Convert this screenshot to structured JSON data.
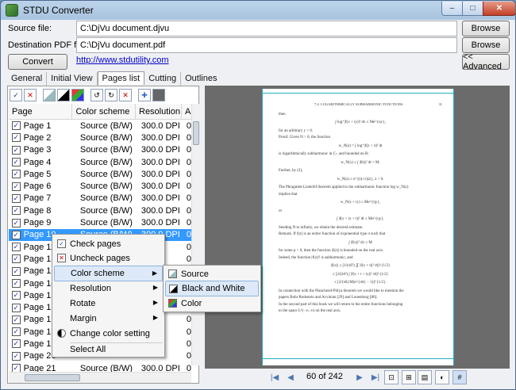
{
  "window": {
    "title": "STDU Converter",
    "min_glyph": "–",
    "max_glyph": "□",
    "close_glyph": "✕"
  },
  "fields": {
    "source_label": "Source file:",
    "source_value": "C:\\DjVu document.djvu",
    "dest_label": "Destination PDF file:",
    "dest_value": "C:\\DjVu document.pdf",
    "browse_label": "Browse"
  },
  "actions": {
    "convert_label": "Convert",
    "website_link": "http://www.stdutility.com",
    "advanced_label": "<< Advanced"
  },
  "tabs": [
    "General",
    "Initial View",
    "Pages list",
    "Cutting",
    "Outlines"
  ],
  "table": {
    "headers": [
      "Page",
      "Color scheme",
      "Resolution",
      "A"
    ],
    "rows": [
      {
        "page": "Page 1",
        "scheme": "Source (B/W)",
        "res": "300.0 DPI",
        "a": "0"
      },
      {
        "page": "Page 2",
        "scheme": "Source (B/W)",
        "res": "300.0 DPI",
        "a": "0"
      },
      {
        "page": "Page 3",
        "scheme": "Source (B/W)",
        "res": "300.0 DPI",
        "a": "0"
      },
      {
        "page": "Page 4",
        "scheme": "Source (B/W)",
        "res": "300.0 DPI",
        "a": "0"
      },
      {
        "page": "Page 5",
        "scheme": "Source (B/W)",
        "res": "300.0 DPI",
        "a": "0"
      },
      {
        "page": "Page 6",
        "scheme": "Source (B/W)",
        "res": "300.0 DPI",
        "a": "0"
      },
      {
        "page": "Page 7",
        "scheme": "Source (B/W)",
        "res": "300.0 DPI",
        "a": "0"
      },
      {
        "page": "Page 8",
        "scheme": "Source (B/W)",
        "res": "300.0 DPI",
        "a": "0"
      },
      {
        "page": "Page 9",
        "scheme": "Source (B/W)",
        "res": "300.0 DPI",
        "a": "0"
      },
      {
        "page": "Page 10",
        "scheme": "Source (B/W)",
        "res": "300.0 DPI",
        "a": "0"
      },
      {
        "page": "Page 11",
        "scheme": "",
        "res": "",
        "a": "0"
      },
      {
        "page": "Page 12",
        "scheme": "",
        "res": "",
        "a": "0"
      },
      {
        "page": "Page 13",
        "scheme": "",
        "res": "",
        "a": "0"
      },
      {
        "page": "Page 14",
        "scheme": "",
        "res": "",
        "a": "0"
      },
      {
        "page": "Page 15",
        "scheme": "",
        "res": "",
        "a": "0"
      },
      {
        "page": "Page 16",
        "scheme": "",
        "res": "",
        "a": "0"
      },
      {
        "page": "Page 17",
        "scheme": "",
        "res": "",
        "a": "0"
      },
      {
        "page": "Page 18",
        "scheme": "",
        "res": "",
        "a": "0"
      },
      {
        "page": "Page 19",
        "scheme": "",
        "res": "",
        "a": "0"
      },
      {
        "page": "Page 20",
        "scheme": "",
        "res": "",
        "a": "0"
      },
      {
        "page": "Page 21",
        "scheme": "Source (B/W)",
        "res": "300.0 DPI",
        "a": "0"
      }
    ]
  },
  "context_menu": {
    "check_pages": "Check pages",
    "uncheck_pages": "Uncheck pages",
    "color_scheme": "Color scheme",
    "resolution": "Resolution",
    "rotate": "Rotate",
    "margin": "Margin",
    "change_color": "Change color setting",
    "select_all": "Select All"
  },
  "submenu": {
    "source": "Source",
    "black_white": "Black and White",
    "color": "Color"
  },
  "preview": {
    "header": "7.4. LOGARITHMICALLY SUBHARMONIC FUNCTIONS",
    "page_no": "31",
    "lines": [
      "then",
      "∫ log⁺|f(x + iy)|² dx ≤ Me^{ηv},",
      "for an arbitrary y > 0.",
      "Proof. Given N > 0, the function",
      "w_N(z) = ∫ log⁺|f(z + t)|² dt",
      "is logarithmically subharmonic in C₊ and bounded on R:",
      "w_N(x) ≤ ∫ |f(t)|² dt = M.",
      "Further, by (3),",
      "w_N(z) ≤ e^{(η+ε)|z|}, z > 0.",
      "The Phragmén-Lindelöf theorem applied to the subharmonic function log w_N(z)",
      "implies that",
      "w_N(x + iy) ≤ Me^{ηy},",
      "or",
      "∫ |f(x + iy + t)|² dt ≤ Me^{ηy}.",
      "Sending N to infinity, we obtain the desired estimate.",
      "Remark. If f(z) is an entire function of exponential type σ such that",
      "∫ |f(x)|² dx ≤ M",
      "for some p > 0, then the function |f(z)| is bounded on the real axis.",
      "Indeed, the function |f(z)|² is subharmonic, and",
      "|f(x)| ≤ [1/(πδ²) ∬ |f(x + t)|² dt]^{1/2}",
      "≤ [2/(πδ²) ∫ |f(x + t + iy)|² dt]^{1/2}",
      "≤ [2/(πδ) M(e^{σδ} − 1)]^{1/2}.",
      "In connection with the Plancherel-Pólya theorem we would like to mention the",
      "papers Bohr Rothstein and Acvinian [29] and Lunenburg [86].",
      "In the second part of this book we will return to the entire functions belonging",
      "to the space Lᵖ(−∞, ∞) on the real axis."
    ]
  },
  "navigation": {
    "page_indicator": "60 of 242"
  },
  "colors": {
    "accent": "#3399ff",
    "link": "#0000cc",
    "preview_bg": "#6b6b6b",
    "page_border": "#1fb0c4"
  }
}
